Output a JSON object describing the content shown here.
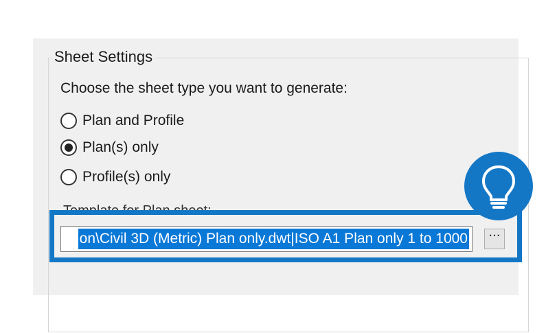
{
  "sheet_settings": {
    "group_title": "Sheet Settings",
    "prompt": "Choose the sheet type you want to generate:",
    "options": [
      {
        "label": "Plan and Profile",
        "checked": false
      },
      {
        "label": "Plan(s) only",
        "checked": true
      },
      {
        "label": "Profile(s) only",
        "checked": false
      }
    ],
    "template_label": "Template for Plan sheet:",
    "template_value": "on\\Civil 3D (Metric) Plan only.dwt|ISO A1 Plan only 1 to 1000",
    "browse_label": "···"
  },
  "tip": {
    "icon": "lightbulb-icon",
    "color": "#1477c6"
  }
}
